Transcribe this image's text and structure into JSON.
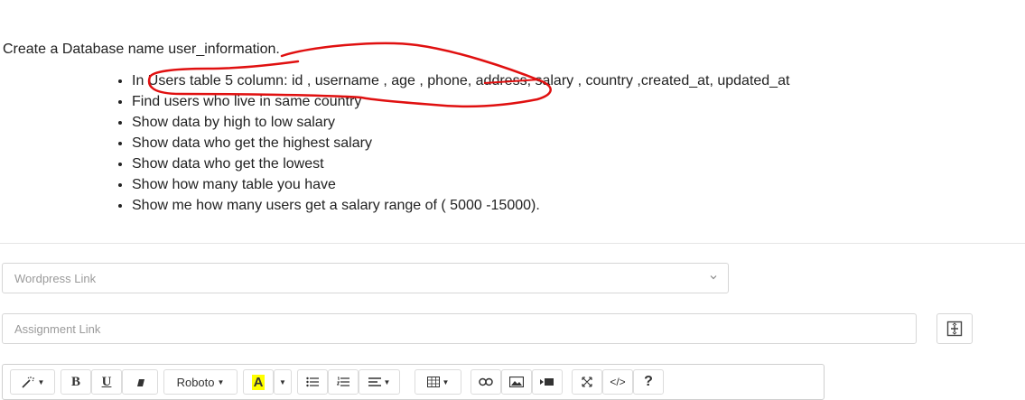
{
  "intro": "Create a Database name  user_information.",
  "tasks": [
    "In  Users table 5 column:  id  , username , age , phone, address, salary , country  ,created_at, updated_at",
    "Find users who live in same country",
    "Show data  by high to low salary",
    "Show data who get the highest salary",
    "Show data who get the lowest",
    "Show how many table you have",
    "Show me how many users get a salary range of ( 5000 -15000)."
  ],
  "form": {
    "wordpress_placeholder": "Wordpress Link",
    "assignment_placeholder": "Assignment Link"
  },
  "toolbar": {
    "bold": "B",
    "underline": "U",
    "font": "Roboto",
    "font_color": "A",
    "code": "</>",
    "help": "?"
  },
  "colors": {
    "scribble": "#e01010",
    "highlight": "#ffff00",
    "border": "#d6d6d6"
  }
}
